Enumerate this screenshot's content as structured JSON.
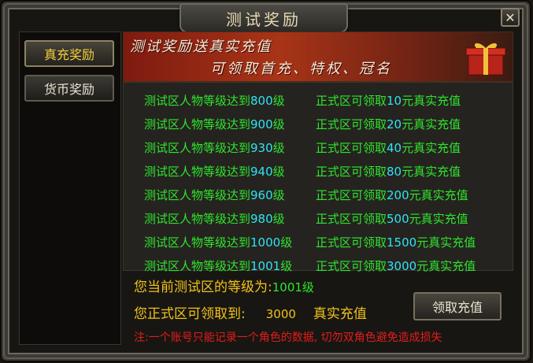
{
  "window": {
    "title": "测试奖励",
    "close_symbol": "✕"
  },
  "tabs": [
    {
      "label": "真充奖励",
      "active": true
    },
    {
      "label": "货币奖励",
      "active": false
    }
  ],
  "banner": {
    "line1": "测试奖励送真实充值",
    "line2": "可领取首充、特权、冠名",
    "icon": "gift-box-icon"
  },
  "rewards": [
    {
      "prefix": "测试区人物等级达到",
      "level": "800",
      "level_suffix": "级",
      "reward_prefix": "正式区可领取",
      "amount": "10",
      "reward_suffix": "元真实充值"
    },
    {
      "prefix": "测试区人物等级达到",
      "level": "900",
      "level_suffix": "级",
      "reward_prefix": "正式区可领取",
      "amount": "20",
      "reward_suffix": "元真实充值"
    },
    {
      "prefix": "测试区人物等级达到",
      "level": "930",
      "level_suffix": "级",
      "reward_prefix": "正式区可领取",
      "amount": "40",
      "reward_suffix": "元真实充值"
    },
    {
      "prefix": "测试区人物等级达到",
      "level": "940",
      "level_suffix": "级",
      "reward_prefix": "正式区可领取",
      "amount": "80",
      "reward_suffix": "元真实充值"
    },
    {
      "prefix": "测试区人物等级达到",
      "level": "960",
      "level_suffix": "级",
      "reward_prefix": "正式区可领取",
      "amount": "200",
      "reward_suffix": "元真实充值"
    },
    {
      "prefix": "测试区人物等级达到",
      "level": "980",
      "level_suffix": "级",
      "reward_prefix": "正式区可领取",
      "amount": "500",
      "reward_suffix": "元真实充值"
    },
    {
      "prefix": "测试区人物等级达到",
      "level": "1000",
      "level_suffix": "级",
      "reward_prefix": "正式区可领取",
      "amount": "1500",
      "reward_suffix": "元真实充值"
    },
    {
      "prefix": "测试区人物等级达到",
      "level": "1001",
      "level_suffix": "级",
      "reward_prefix": "正式区可领取",
      "amount": "3000",
      "reward_suffix": "元真实充值"
    }
  ],
  "status": {
    "current_level_label": "您当前测试区的等级为:",
    "current_level_value": "1001级",
    "claimable_label": "您正式区可领取到:",
    "claimable_amount": "3000",
    "claimable_unit": "真实充值"
  },
  "claim_button": {
    "label": "领取充值"
  },
  "note": "注:一个账号只能记录一个角色的数据, 切勿双角色避免造成损失",
  "colors": {
    "green": "#2ee52e",
    "cyan": "#2fe3f2",
    "gold": "#f1c21b",
    "red": "#e41c1c"
  }
}
